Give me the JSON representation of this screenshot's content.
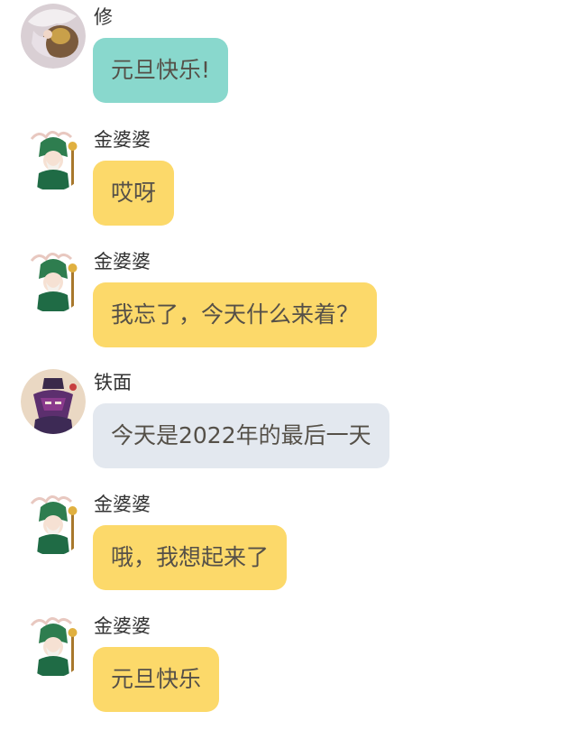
{
  "colors": {
    "xiu_bubble": "#89d8cd",
    "granny_bubble": "#fcd96a",
    "tiemian_bubble": "#e3e8ef"
  },
  "messages": [
    {
      "sender": "修",
      "avatar": "xiu-portrait-icon",
      "text": "元旦快乐!"
    },
    {
      "sender": "金婆婆",
      "avatar": "granny-jin-portrait-icon",
      "text": "哎呀"
    },
    {
      "sender": "金婆婆",
      "avatar": "granny-jin-portrait-icon",
      "text": "我忘了，今天什么来着？"
    },
    {
      "sender": "铁面",
      "avatar": "tiemian-portrait-icon",
      "text": "今天是2022年的最后一天"
    },
    {
      "sender": "金婆婆",
      "avatar": "granny-jin-portrait-icon",
      "text": "哦，我想起来了"
    },
    {
      "sender": "金婆婆",
      "avatar": "granny-jin-portrait-icon",
      "text": "元旦快乐"
    }
  ]
}
